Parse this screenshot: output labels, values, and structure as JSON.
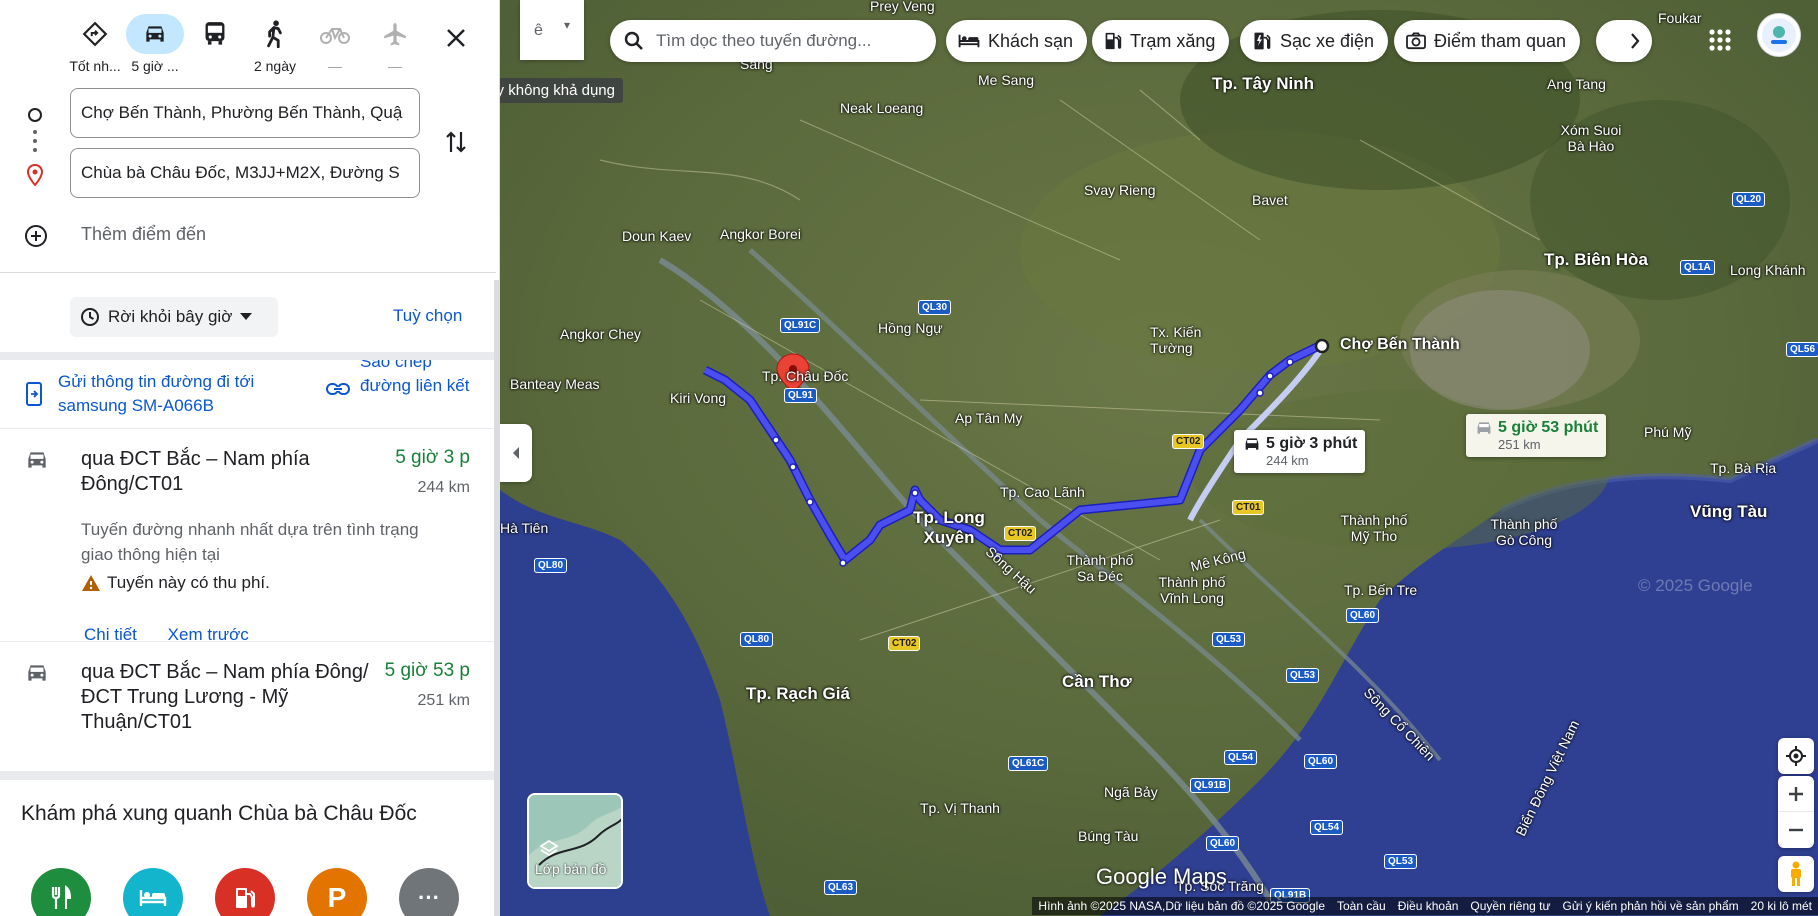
{
  "modes": [
    {
      "name": "best",
      "label": "Tốt nh...",
      "icon": "diamond-directions-icon"
    },
    {
      "name": "drive",
      "label": "5 giờ ...",
      "icon": "car-icon"
    },
    {
      "name": "transit",
      "label": "",
      "icon": "bus-icon"
    },
    {
      "name": "walk",
      "label": "2 ngày",
      "icon": "walking-icon"
    },
    {
      "name": "bike",
      "label": "—",
      "icon": "bicycle-icon"
    },
    {
      "name": "flight",
      "label": "—",
      "icon": "airplane-icon"
    }
  ],
  "tooltip": "Chuyến bay không khả dụng",
  "origin": "Chợ Bến Thành, Phường Bến Thành, Quậ",
  "destination": "Chùa bà Châu Đốc, M3JJ+M2X, Đường S",
  "add_destination": "Thêm điểm đến",
  "depart_label": "Rời khỏi bây giờ",
  "options_label": "Tuỳ chọn",
  "send_label": "Gửi thông tin đường đi tới samsung SM-A066B",
  "copy_label": "Sao chép đường liên kết",
  "routes": [
    {
      "name": "qua ĐCT Bắc – Nam phía Đông/CT01",
      "time": "5 giờ 3 p",
      "distance": "244 km",
      "description": "Tuyến đường nhanh nhất dựa trên tình trạng giao thông hiện tại",
      "warning": "Tuyến này có thu phí.",
      "details_label": "Chi tiết",
      "preview_label": "Xem trước"
    },
    {
      "name": "qua ĐCT Bắc – Nam phía Đông/ĐCT Trung Lương - Mỹ Thuận/CT01",
      "time": "5 giờ 53 p",
      "distance": "251 km"
    }
  ],
  "explore_title": "Khám phá xung quanh Chùa bà Châu Đốc",
  "explore_categories": [
    {
      "icon": "restaurant-icon",
      "color": "#1e8e3e",
      "glyph": ""
    },
    {
      "icon": "hotel-icon",
      "color": "#12b5cb",
      "glyph": ""
    },
    {
      "icon": "gas-station-icon",
      "color": "#d93025",
      "glyph": ""
    },
    {
      "icon": "parking-icon",
      "color": "#e37400",
      "glyph": "P"
    },
    {
      "icon": "more-icon",
      "color": "#70757a",
      "glyph": "···"
    }
  ],
  "map": {
    "search_placeholder": "Tìm dọc theo tuyến đường...",
    "chips": [
      "Khách sạn",
      "Trạm xăng",
      "Sạc xe điện",
      "Điểm tham quan"
    ],
    "side_toggle": "ê",
    "route_bubble_main": {
      "time": "5 giờ 3 phút",
      "distance": "244 km"
    },
    "route_bubble_alt": {
      "time": "5 giờ 53 phút",
      "distance": "251 km"
    },
    "layer_label": "Lớp bản đồ",
    "logo": "Google Maps",
    "watermark": "© 2025 Google",
    "attribution": [
      "Hình ảnh ©2025 NASA,Dữ liệu bản đồ ©2025 Google",
      "Toàn cầu",
      "Điều khoản",
      "Quyền riêng tư",
      "Gửi ý kiến phản hồi về sản phẩm",
      "20 ki lô mét"
    ],
    "labels": [
      {
        "text": "Prey Veng",
        "cls": ""
      },
      {
        "text": "Foukar",
        "cls": ""
      },
      {
        "text": "Sang",
        "cls": ""
      },
      {
        "text": "Me Sang",
        "cls": ""
      },
      {
        "text": "Tp. Tây Ninh",
        "cls": "big"
      },
      {
        "text": "Ang Tang",
        "cls": ""
      },
      {
        "text": "Neak Loeang",
        "cls": ""
      },
      {
        "text": "Xóm Suoi Bà Hào",
        "cls": ""
      },
      {
        "text": "Svay Rieng",
        "cls": ""
      },
      {
        "text": "Bavet",
        "cls": ""
      },
      {
        "text": "Doun Kaev",
        "cls": ""
      },
      {
        "text": "Angkor Borei",
        "cls": ""
      },
      {
        "text": "Tp. Biên Hòa",
        "cls": "big"
      },
      {
        "text": "Long Khánh",
        "cls": ""
      },
      {
        "text": "Hồng Ngự",
        "cls": ""
      },
      {
        "text": "Angkor Chey",
        "cls": ""
      },
      {
        "text": "Tx. Kiến Tường",
        "cls": ""
      },
      {
        "text": "Chợ Bến Thành",
        "cls": "city"
      },
      {
        "text": "Banteay Meas",
        "cls": ""
      },
      {
        "text": "Kiri Vong",
        "cls": ""
      },
      {
        "text": "Tp. Châu Đốc",
        "cls": ""
      },
      {
        "text": "Ap Tân My",
        "cls": ""
      },
      {
        "text": "Phú Mỹ",
        "cls": ""
      },
      {
        "text": "Tp. Bà Rịa",
        "cls": ""
      },
      {
        "text": "Tp. Cao Lãnh",
        "cls": ""
      },
      {
        "text": "Tp. Long Xuyên",
        "cls": "big"
      },
      {
        "text": "Hà Tiên",
        "cls": ""
      },
      {
        "text": "Vũng Tàu",
        "cls": "big"
      },
      {
        "text": "Thành phố Mỹ Tho",
        "cls": ""
      },
      {
        "text": "Thành phố Gò Công",
        "cls": ""
      },
      {
        "text": "Thành phố Sa Đéc",
        "cls": ""
      },
      {
        "text": "Thành phố Vĩnh Long",
        "cls": ""
      },
      {
        "text": "Tp. Bến Tre",
        "cls": ""
      },
      {
        "text": "Mê Kông",
        "cls": ""
      },
      {
        "text": "Sông Hậu",
        "cls": ""
      },
      {
        "text": "Tp. Rạch Giá",
        "cls": "big"
      },
      {
        "text": "Cần Thơ",
        "cls": "big"
      },
      {
        "text": "Sông Cổ Chiên",
        "cls": ""
      },
      {
        "text": "Biển Đông Việt Nam",
        "cls": ""
      },
      {
        "text": "Ngã Bảy",
        "cls": ""
      },
      {
        "text": "Tp. Vị Thanh",
        "cls": ""
      },
      {
        "text": "Búng Tàu",
        "cls": ""
      },
      {
        "text": "Tp. Sóc Trăng",
        "cls": ""
      }
    ],
    "shields": [
      {
        "text": "QL91C",
        "y": false
      },
      {
        "text": "QL30",
        "y": false
      },
      {
        "text": "QL91",
        "y": false
      },
      {
        "text": "CT02",
        "y": true
      },
      {
        "text": "CT01",
        "y": true
      },
      {
        "text": "CT02",
        "y": true
      },
      {
        "text": "QL80",
        "y": false
      },
      {
        "text": "QL80",
        "y": false
      },
      {
        "text": "CT02",
        "y": true
      },
      {
        "text": "QL53",
        "y": false
      },
      {
        "text": "QL60",
        "y": false
      },
      {
        "text": "QL53",
        "y": false
      },
      {
        "text": "QL61C",
        "y": false
      },
      {
        "text": "QL54",
        "y": false
      },
      {
        "text": "QL60",
        "y": false
      },
      {
        "text": "QL91B",
        "y": false
      },
      {
        "text": "QL54",
        "y": false
      },
      {
        "text": "QL60",
        "y": false
      },
      {
        "text": "QL53",
        "y": false
      },
      {
        "text": "QL63",
        "y": false
      },
      {
        "text": "QL91B",
        "y": false
      },
      {
        "text": "QL20",
        "y": false
      },
      {
        "text": "QL1A",
        "y": false
      },
      {
        "text": "QL56",
        "y": false
      }
    ]
  }
}
